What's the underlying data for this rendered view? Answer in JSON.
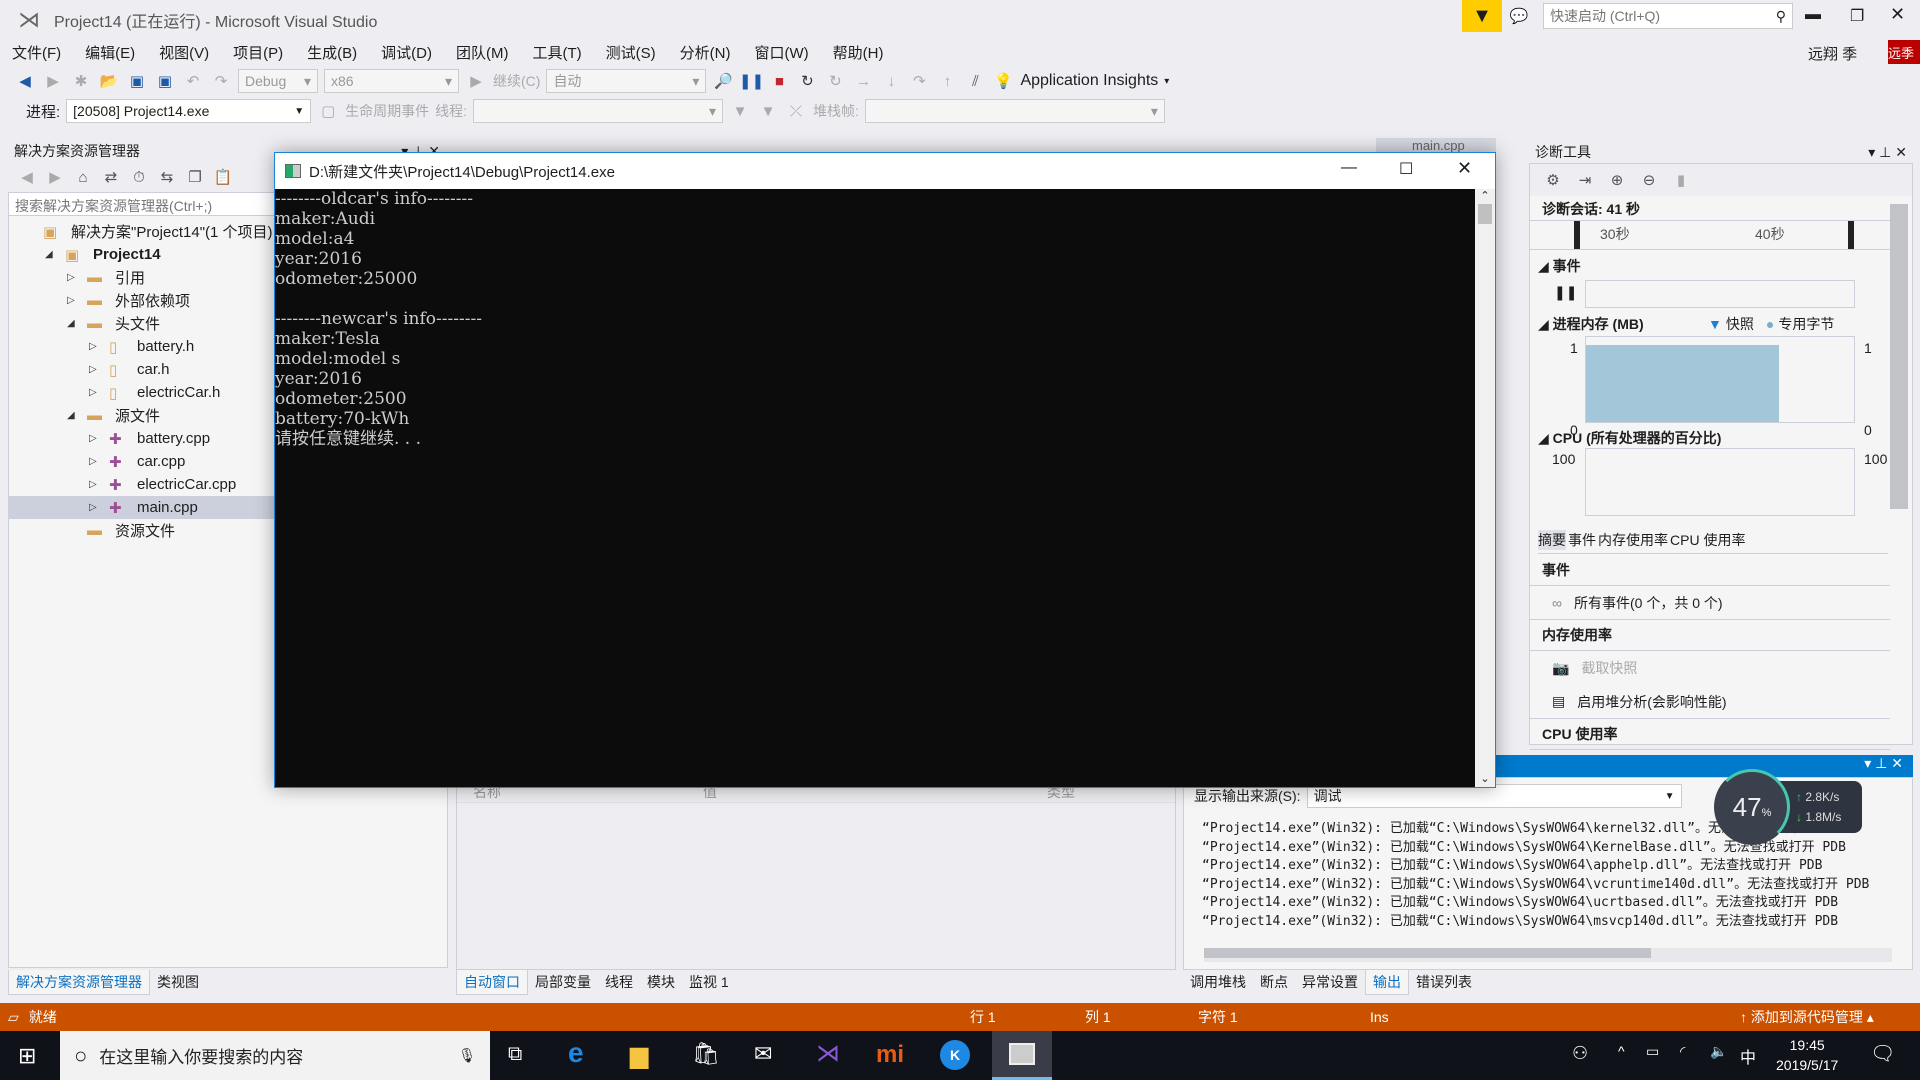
{
  "window": {
    "title": "Project14 (正在运行) - Microsoft Visual Studio",
    "quick_launch_placeholder": "快速启动 (Ctrl+Q)",
    "user": "远翔 季",
    "user_badge": "远季"
  },
  "menu": [
    "文件(F)",
    "编辑(E)",
    "视图(V)",
    "项目(P)",
    "生成(B)",
    "调试(D)",
    "团队(M)",
    "工具(T)",
    "测试(S)",
    "分析(N)",
    "窗口(W)",
    "帮助(H)"
  ],
  "toolbar": {
    "config": "Debug",
    "platform": "x86",
    "continue": "继续(C)",
    "auto": "自动",
    "app_insights": "Application Insights",
    "process_label": "进程:",
    "process": "[20508] Project14.exe",
    "lifecycle": "生命周期事件",
    "thread_label": "线程:",
    "stack_label": "堆栈帧:"
  },
  "solution_explorer": {
    "title": "解决方案资源管理器",
    "search_placeholder": "搜索解决方案资源管理器(Ctrl+;)",
    "items": [
      {
        "label": "解决方案\"Project14\"(1 个项目)",
        "level": 0,
        "exp": ""
      },
      {
        "label": "Project14",
        "level": 1,
        "exp": "◢",
        "bold": true
      },
      {
        "label": "引用",
        "level": 2,
        "exp": "▷"
      },
      {
        "label": "外部依赖项",
        "level": 2,
        "exp": "▷"
      },
      {
        "label": "头文件",
        "level": 2,
        "exp": "◢"
      },
      {
        "label": "battery.h",
        "level": 3,
        "exp": "▷"
      },
      {
        "label": "car.h",
        "level": 3,
        "exp": "▷"
      },
      {
        "label": "electricCar.h",
        "level": 3,
        "exp": "▷"
      },
      {
        "label": "源文件",
        "level": 2,
        "exp": "◢"
      },
      {
        "label": "battery.cpp",
        "level": 3,
        "exp": "▷"
      },
      {
        "label": "car.cpp",
        "level": 3,
        "exp": "▷"
      },
      {
        "label": "electricCar.cpp",
        "level": 3,
        "exp": "▷"
      },
      {
        "label": "main.cpp",
        "level": 3,
        "exp": "▷",
        "selected": true
      },
      {
        "label": "资源文件",
        "level": 2,
        "exp": ""
      }
    ],
    "tabs": [
      "解决方案资源管理器",
      "类视图"
    ]
  },
  "editor_tab": "main.cpp",
  "console": {
    "title": "D:\\新建文件夹\\Project14\\Debug\\Project14.exe",
    "lines": [
      "--------oldcar's info--------",
      "maker:Audi",
      "model:a4",
      "year:2016",
      "odometer:25000",
      "",
      "--------newcar's info--------",
      "maker:Tesla",
      "model:model s",
      "year:2016",
      "odometer:2500",
      "battery:70-kWh",
      "请按任意键继续. . ."
    ]
  },
  "autos": {
    "columns": [
      "名称",
      "值",
      "类型"
    ],
    "tabs": [
      "自动窗口",
      "局部变量",
      "线程",
      "模块",
      "监视 1"
    ]
  },
  "diagnostics": {
    "title": "诊断工具",
    "session": "诊断会话: 41 秒",
    "ticks": [
      "30秒",
      "40秒"
    ],
    "events_label": "事件",
    "memory_label": "进程内存 (MB)",
    "legend_snapshot": "快照",
    "legend_private": "专用字节",
    "mem_max": "1",
    "mem_min": "0",
    "cpu_label": "CPU (所有处理器的百分比)",
    "cpu_max": "100",
    "tabs": [
      "摘要",
      "事件",
      "内存使用率",
      "CPU 使用率"
    ],
    "sec_events": "事件",
    "all_events": "所有事件(0 个，共 0 个)",
    "sec_memory": "内存使用率",
    "snapshot": "截取快照",
    "heap": "启用堆分析(会影响性能)",
    "sec_cpu": "CPU 使用率"
  },
  "output": {
    "source_label": "显示输出来源(S):",
    "source": "调试",
    "lines": [
      "“Project14.exe”(Win32): 已加载“C:\\Windows\\SysWOW64\\kernel32.dll”。无法查找或打开 PDB",
      "“Project14.exe”(Win32): 已加载“C:\\Windows\\SysWOW64\\KernelBase.dll”。无法查找或打开 PDB",
      "“Project14.exe”(Win32): 已加载“C:\\Windows\\SysWOW64\\apphelp.dll”。无法查找或打开 PDB",
      "“Project14.exe”(Win32): 已加载“C:\\Windows\\SysWOW64\\vcruntime140d.dll”。无法查找或打开 PDB",
      "“Project14.exe”(Win32): 已加载“C:\\Windows\\SysWOW64\\ucrtbased.dll”。无法查找或打开 PDB",
      "“Project14.exe”(Win32): 已加载“C:\\Windows\\SysWOW64\\msvcp140d.dll”。无法查找或打开 PDB"
    ],
    "tabs": [
      "调用堆栈",
      "断点",
      "异常设置",
      "输出",
      "错误列表"
    ]
  },
  "net_widget": {
    "percent": "47",
    "unit": "%",
    "up": "2.8K/s",
    "down": "1.8M/s"
  },
  "status": {
    "ready": "就绪",
    "row": "行 1",
    "col": "列 1",
    "char": "字符 1",
    "ins": "Ins",
    "scm": "添加到源代码管理"
  },
  "taskbar": {
    "search": "在这里输入你要搜索的内容",
    "time": "19:45",
    "date": "2019/5/17",
    "ime": "中"
  },
  "colors": {
    "accent": "#007acc",
    "status": "#ca5100",
    "memory_fill": "#a3c6d9"
  },
  "memory_fill_fraction": 0.72
}
